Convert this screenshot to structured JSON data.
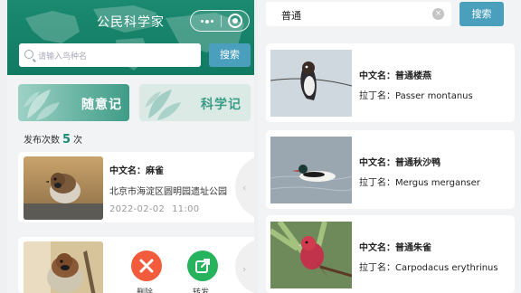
{
  "left_panel": {
    "app_title": "公民科学家",
    "search": {
      "placeholder": "请输入鸟种名",
      "button_label": "搜索"
    },
    "cards": [
      {
        "label": "随意记"
      },
      {
        "label": "科学记"
      }
    ],
    "publish_count": {
      "prefix": "发布次数",
      "count": "5",
      "suffix": "次"
    },
    "records": [
      {
        "name": "中文名：麻雀",
        "location": "北京市海淀区圆明园遗址公园",
        "date": "2022-02-02",
        "time": "11:00"
      }
    ],
    "swipe_actions": [
      {
        "label": "删除",
        "icon": "close-icon",
        "color": "#f25c3d"
      },
      {
        "label": "转发",
        "icon": "share-icon",
        "color": "#27b25d"
      }
    ],
    "colors": {
      "header": "#117a62",
      "accent": "#1a8a70",
      "button": "#4a9fbd"
    }
  },
  "right_panel": {
    "search": {
      "value": "普通",
      "button_label": "搜索"
    },
    "results": [
      {
        "chinese_name": "中文名：普通楼燕",
        "latin_name": "拉丁名：Passer montanus"
      },
      {
        "chinese_name": "中文名：普通秋沙鸭",
        "latin_name": "拉丁名：Mergus merganser"
      },
      {
        "chinese_name": "中文名：普通朱雀",
        "latin_name": "拉丁名：Carpodacus erythrinus"
      }
    ]
  }
}
